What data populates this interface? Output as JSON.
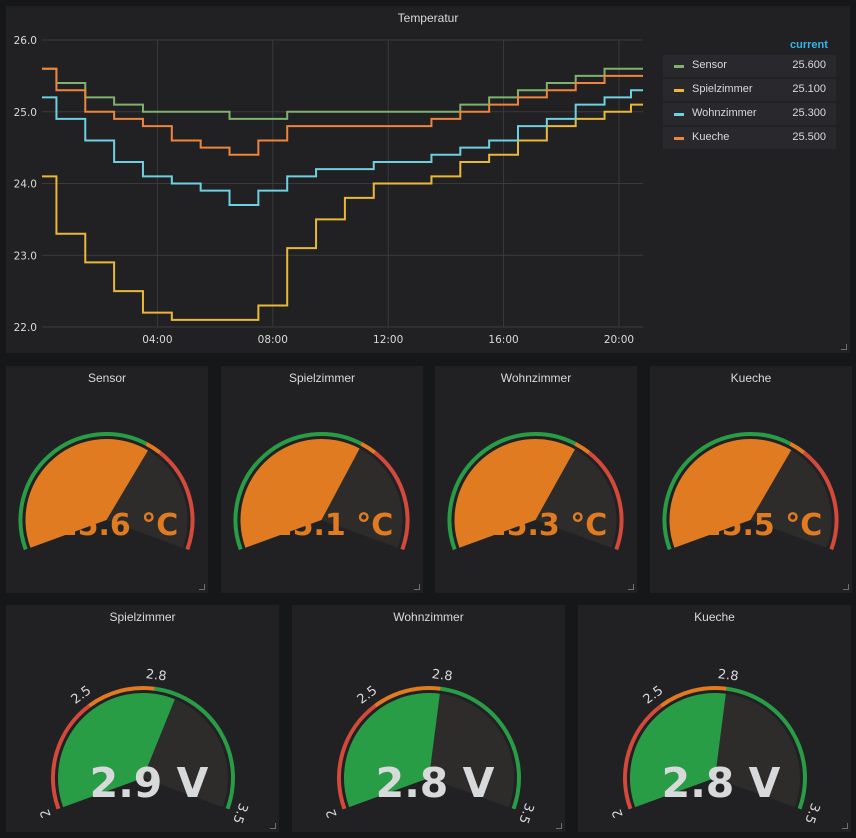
{
  "temperature_panel": {
    "title": "Temperatur",
    "legend_header": "current",
    "y_ticks": [
      "26.0",
      "25.0",
      "24.0",
      "23.0",
      "22.0"
    ],
    "x_ticks": [
      "04:00",
      "08:00",
      "12:00",
      "16:00",
      "20:00"
    ],
    "series_legend": [
      {
        "name": "Sensor",
        "value": "25.600",
        "color": "#7eb26d"
      },
      {
        "name": "Spielzimmer",
        "value": "25.100",
        "color": "#eab839"
      },
      {
        "name": "Wohnzimmer",
        "value": "25.300",
        "color": "#6ed0e0"
      },
      {
        "name": "Kueche",
        "value": "25.500",
        "color": "#ef843c"
      }
    ]
  },
  "temp_gauges": [
    {
      "title": "Sensor",
      "value": 25.6,
      "display": "25.6 °C"
    },
    {
      "title": "Spielzimmer",
      "value": 25.1,
      "display": "25.1 °C"
    },
    {
      "title": "Wohnzimmer",
      "value": 25.3,
      "display": "25.3 °C"
    },
    {
      "title": "Kueche",
      "value": 25.5,
      "display": "25.5 °C"
    }
  ],
  "volt_gauges": [
    {
      "title": "Spielzimmer",
      "value": 2.9,
      "display": "2.9 V"
    },
    {
      "title": "Wohnzimmer",
      "value": 2.8,
      "display": "2.8 V"
    },
    {
      "title": "Kueche",
      "value": 2.8,
      "display": "2.8 V"
    }
  ],
  "volt_scale": {
    "min": 2,
    "max": 3.5,
    "labels": [
      "2",
      "2.5",
      "2.8",
      "3.5"
    ]
  },
  "colors": {
    "gauge_temp_fill": "#e07b22",
    "gauge_volt_fill": "#299c46",
    "threshold_green": "#299c46",
    "threshold_orange": "#e07b22",
    "threshold_red": "#d44a3a",
    "gauge_track": "#2d2c2b"
  },
  "chart_data": {
    "type": "line",
    "title": "Temperatur",
    "xlabel": "",
    "ylabel": "",
    "x_ticks": [
      "04:00",
      "08:00",
      "12:00",
      "16:00",
      "20:00"
    ],
    "ylim": [
      22.0,
      26.0
    ],
    "grid": true,
    "legend": "right",
    "x": [
      "00:00",
      "01:00",
      "02:00",
      "03:00",
      "04:00",
      "05:00",
      "06:00",
      "07:00",
      "08:00",
      "09:00",
      "10:00",
      "11:00",
      "12:00",
      "13:00",
      "14:00",
      "15:00",
      "16:00",
      "17:00",
      "18:00",
      "19:00",
      "20:00",
      "20:50"
    ],
    "series": [
      {
        "name": "Sensor",
        "color": "#7eb26d",
        "values": [
          25.6,
          25.4,
          25.2,
          25.1,
          25.0,
          25.0,
          25.0,
          24.9,
          24.9,
          25.0,
          25.0,
          25.0,
          25.0,
          25.0,
          25.0,
          25.1,
          25.2,
          25.3,
          25.4,
          25.5,
          25.6,
          25.6
        ]
      },
      {
        "name": "Spielzimmer",
        "color": "#eab839",
        "values": [
          24.1,
          23.3,
          22.9,
          22.5,
          22.2,
          22.1,
          22.1,
          22.1,
          22.3,
          23.1,
          23.5,
          23.8,
          24.0,
          24.0,
          24.1,
          24.3,
          24.4,
          24.6,
          24.8,
          24.9,
          25.0,
          25.1
        ]
      },
      {
        "name": "Wohnzimmer",
        "color": "#6ed0e0",
        "values": [
          25.2,
          24.9,
          24.6,
          24.3,
          24.1,
          24.0,
          23.9,
          23.7,
          23.9,
          24.1,
          24.2,
          24.2,
          24.3,
          24.3,
          24.4,
          24.5,
          24.6,
          24.8,
          24.9,
          25.1,
          25.2,
          25.3
        ]
      },
      {
        "name": "Kueche",
        "color": "#ef843c",
        "values": [
          25.6,
          25.3,
          25.0,
          24.9,
          24.8,
          24.6,
          24.5,
          24.4,
          24.6,
          24.8,
          24.8,
          24.8,
          24.8,
          24.8,
          24.9,
          25.0,
          25.1,
          25.2,
          25.3,
          25.4,
          25.5,
          25.5
        ]
      }
    ]
  }
}
